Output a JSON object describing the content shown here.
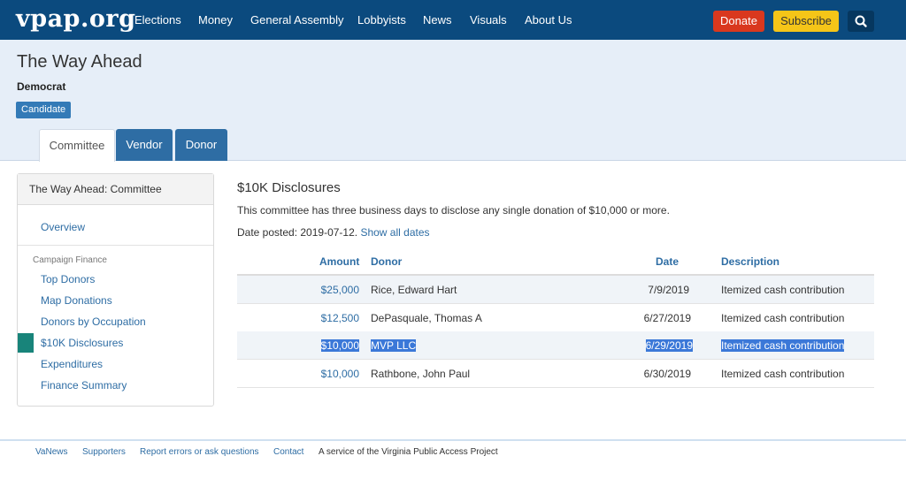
{
  "nav": {
    "logo": "vpap.org",
    "links": [
      "Elections",
      "Money",
      "General Assembly",
      "Lobbyists",
      "News",
      "Visuals",
      "About Us"
    ],
    "donate": "Donate",
    "subscribe": "Subscribe",
    "colors": {
      "bar": "#0b4a7e",
      "donate": "#d9381e",
      "subscribe": "#f5c518"
    }
  },
  "header": {
    "title": "The Way Ahead",
    "party": "Democrat",
    "badge": "Candidate",
    "tabs": [
      "Committee",
      "Vendor",
      "Donor"
    ],
    "active_tab": "Committee"
  },
  "sidebar": {
    "heading": "The Way Ahead: Committee",
    "overview": "Overview",
    "section": "Campaign Finance",
    "items": [
      "Top Donors",
      "Map Donations",
      "Donors by Occupation",
      "$10K Disclosures",
      "Expenditures",
      "Finance Summary"
    ],
    "active_item": "$10K Disclosures",
    "active_color": "#18847a"
  },
  "main": {
    "title": "$10K Disclosures",
    "description": "This committee has three business days to disclose any single donation of $10,000 or more.",
    "date_posted": "Date posted: 2019-07-12.",
    "show_all": "Show all dates",
    "columns": [
      "Amount",
      "Donor",
      "Date",
      "Description"
    ],
    "rows": [
      {
        "amount": "$25,000",
        "donor": "Rice, Edward Hart",
        "date": "7/9/2019",
        "description": "Itemized cash contribution"
      },
      {
        "amount": "$12,500",
        "donor": "DePasquale, Thomas A",
        "date": "6/27/2019",
        "description": "Itemized cash contribution"
      },
      {
        "amount": "$10,000",
        "donor": "MVP LLC",
        "date": "6/29/2019",
        "description": "Itemized cash contribution",
        "selected": true
      },
      {
        "amount": "$10,000",
        "donor": "Rathbone, John Paul",
        "date": "6/30/2019",
        "description": "Itemized cash contribution"
      }
    ]
  },
  "footer": {
    "links": [
      "VaNews",
      "Supporters",
      "Report errors or ask questions",
      "Contact"
    ],
    "service": "A service of the Virginia Public Access Project"
  }
}
